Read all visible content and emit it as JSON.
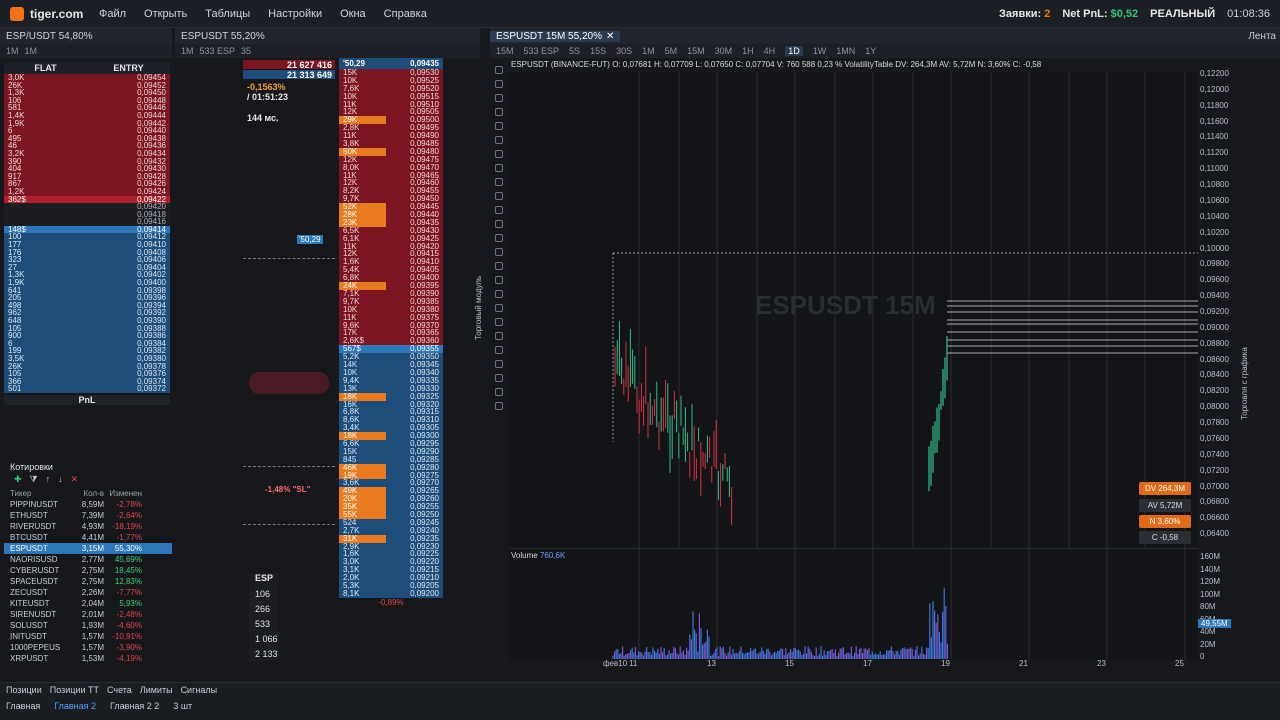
{
  "app": {
    "logo": "tiger.com",
    "menu": [
      "Файл",
      "Открыть",
      "Таблицы",
      "Настройки",
      "Окна",
      "Справка"
    ],
    "orders_label": "Заявки:",
    "orders_count": "2",
    "netpnl_label": "Net PnL:",
    "netpnl_value": "$0,52",
    "mode": "РЕАЛЬНЫЙ",
    "clock": "01:08:36"
  },
  "tabs": {
    "left": "ESP/USDT 54,80%",
    "middle": "ESPUSDT 55,20%",
    "chart": "ESPUSDT 15M 55,20%",
    "feed": "Лента"
  },
  "toolbar_left": [
    "1M",
    "1M"
  ],
  "toolbar_mid": [
    "1M",
    "533 ESP",
    "35"
  ],
  "toolbar_chart": [
    "15M",
    "533 ESP",
    "5S",
    "15S",
    "30S",
    "1M",
    "5M",
    "15M",
    "30M",
    "1H",
    "4H",
    "1D",
    "1W",
    "1MN",
    "1Y"
  ],
  "flat": {
    "col1": "FLAT",
    "col2": "ENTRY",
    "red_rows": [
      [
        "3,0K",
        "0,09454"
      ],
      [
        "26K",
        "0,09452"
      ],
      [
        "1,3K",
        "0,09450"
      ],
      [
        "106",
        "0,09448"
      ],
      [
        "581",
        "0,09446"
      ],
      [
        "1,4K",
        "0,09444"
      ],
      [
        "1,9K",
        "0,09442"
      ],
      [
        "6",
        "0,09440"
      ],
      [
        "495",
        "0,09438"
      ],
      [
        "46",
        "0,09436"
      ],
      [
        "3,2K",
        "0,09434"
      ],
      [
        "390",
        "0,09432"
      ],
      [
        "404",
        "0,09430"
      ],
      [
        "917",
        "0,09428"
      ],
      [
        "867",
        "0,09426"
      ],
      [
        "1,2K",
        "0,09424"
      ]
    ],
    "hl_row": [
      "362$",
      "0,09422"
    ],
    "dark_rows": [
      [
        "",
        "0,09420"
      ],
      [
        "",
        "0,09418"
      ],
      [
        "",
        "0,09416"
      ]
    ],
    "sel_row": [
      "148$",
      "0,09414"
    ],
    "blue_rows": [
      [
        "100",
        "0,09412"
      ],
      [
        "177",
        "0,09410"
      ],
      [
        "176",
        "0,09408"
      ],
      [
        "323",
        "0,09406"
      ],
      [
        "27",
        "0,09404"
      ],
      [
        "1,3K",
        "0,09402"
      ],
      [
        "1,9K",
        "0,09400"
      ],
      [
        "641",
        "0,09398"
      ],
      [
        "205",
        "0,09396"
      ],
      [
        "498",
        "0,09394"
      ],
      [
        "962",
        "0,09392"
      ],
      [
        "648",
        "0,09390"
      ],
      [
        "105",
        "0,09388"
      ],
      [
        "900",
        "0,09386"
      ],
      [
        "6",
        "0,09384"
      ],
      [
        "199",
        "0,09382"
      ],
      [
        "3,5K",
        "0,09380"
      ],
      [
        "26K",
        "0,09378"
      ],
      [
        "105",
        "0,09376"
      ],
      [
        "366",
        "0,09374"
      ],
      [
        "501",
        "0,09372"
      ]
    ],
    "pnl": "PnL"
  },
  "mid": {
    "vol1": "21 627 416",
    "vol2": "21 313 649",
    "pct": "-0,1563%",
    "time": "/ 01:51:23",
    "latency": "144 мс.",
    "marker": "'50,29",
    "sl": "-1,48% \"SL\"",
    "esp_label": "ESP",
    "esp_vals": [
      "106",
      "266",
      "533",
      "1 066",
      "2 133"
    ]
  },
  "ladder": {
    "top_price": "0,09435",
    "top_label": "'50,29",
    "red": [
      [
        "15K",
        "0,09530"
      ],
      [
        "10K",
        "0,09525"
      ],
      [
        "7,6K",
        "0,09520"
      ],
      [
        "10K",
        "0,09515"
      ],
      [
        "11K",
        "0,09510"
      ],
      [
        "12K",
        "0,09505"
      ],
      [
        "29K",
        "0,09500"
      ],
      [
        "2,8K",
        "0,09495"
      ],
      [
        "11K",
        "0,09490"
      ],
      [
        "3,8K",
        "0,09485"
      ],
      [
        "50K",
        "0,09480"
      ],
      [
        "12K",
        "0,09475"
      ],
      [
        "8,0K",
        "0,09470"
      ],
      [
        "11K",
        "0,09465"
      ],
      [
        "12K",
        "0,09460"
      ],
      [
        "8,2K",
        "0,09455"
      ],
      [
        "9,7K",
        "0,09450"
      ],
      [
        "52K",
        "0,09445"
      ],
      [
        "28K",
        "0,09440"
      ],
      [
        "23K",
        "0,09435"
      ],
      [
        "6,5K",
        "0,09430"
      ],
      [
        "6,1K",
        "0,09425"
      ],
      [
        "11K",
        "0,09420"
      ],
      [
        "12K",
        "0,09415"
      ],
      [
        "1,6K",
        "0,09410"
      ],
      [
        "5,4K",
        "0,09405"
      ],
      [
        "6,8K",
        "0,09400"
      ],
      [
        "24K",
        "0,09395"
      ],
      [
        "7,1K",
        "0,09390"
      ],
      [
        "9,7K",
        "0,09385"
      ],
      [
        "10K",
        "0,09380"
      ],
      [
        "11K",
        "0,09375"
      ],
      [
        "9,6K",
        "0,09370"
      ],
      [
        "17K",
        "0,09365"
      ],
      [
        "2,6K$",
        "0,09360"
      ]
    ],
    "cur": [
      "567$",
      "0,09355"
    ],
    "blue": [
      [
        "5,2K",
        "0,09350"
      ],
      [
        "14K",
        "0,09345"
      ],
      [
        "10K",
        "0,09340"
      ],
      [
        "9,4K",
        "0,09335"
      ],
      [
        "13K",
        "0,09330"
      ],
      [
        "18K",
        "0,09325"
      ],
      [
        "16K",
        "0,09320"
      ],
      [
        "6,8K",
        "0,09315"
      ],
      [
        "8,6K",
        "0,09310"
      ],
      [
        "3,4K",
        "0,09305"
      ],
      [
        "18K",
        "0,09300"
      ],
      [
        "6,6K",
        "0,09295"
      ],
      [
        "15K",
        "0,09290"
      ],
      [
        "845",
        "0,09285"
      ],
      [
        "46K",
        "0,09280"
      ],
      [
        "19K",
        "0,09275"
      ],
      [
        "3,6K",
        "0,09270"
      ],
      [
        "49K",
        "0,09265"
      ],
      [
        "20K",
        "0,09260"
      ],
      [
        "35K",
        "0,09255"
      ],
      [
        "55K",
        "0,09250"
      ],
      [
        "524",
        "0,09245"
      ],
      [
        "2,7K",
        "0,09240"
      ],
      [
        "31K",
        "0,09235"
      ],
      [
        "2,9K",
        "0,09230"
      ],
      [
        "1,6K",
        "0,09225"
      ],
      [
        "3,0K",
        "0,09220"
      ],
      [
        "3,1K",
        "0,09215"
      ],
      [
        "2,0K",
        "0,09210"
      ],
      [
        "5,3K",
        "0,09205"
      ],
      [
        "8,1K",
        "0,09200"
      ]
    ],
    "bottom": "-0,89%"
  },
  "quotes": {
    "title": "Котировки",
    "col1": "Тикер",
    "col2": "Кол-в",
    "col3": "Изменен",
    "rows": [
      [
        "PIPPINUSDT",
        "8,59M",
        "-2,78%",
        "neg"
      ],
      [
        "ETHUSDT",
        "7,39M",
        "-2,64%",
        "neg"
      ],
      [
        "RIVERUSDT",
        "4,93M",
        "-18,19%",
        "neg"
      ],
      [
        "BTCUSDT",
        "4,41M",
        "-1,77%",
        "neg"
      ],
      [
        "ESPUSDT",
        "3,15M",
        "55,30%",
        "sel"
      ],
      [
        "NAORISUSD",
        "2,77M",
        "45,69%",
        "pos"
      ],
      [
        "CYBERUSDT",
        "2,75M",
        "18,45%",
        "pos"
      ],
      [
        "SPACEUSDT",
        "2,75M",
        "12,83%",
        "pos"
      ],
      [
        "ZECUSDT",
        "2,26M",
        "-7,77%",
        "neg"
      ],
      [
        "KITEUSDT",
        "2,04M",
        "5,93%",
        "pos"
      ],
      [
        "SIRENUSDT",
        "2,01M",
        "-2,48%",
        "neg"
      ],
      [
        "SOLUSDT",
        "1,93M",
        "-4,60%",
        "neg"
      ],
      [
        "INITUSDT",
        "1,57M",
        "-10,91%",
        "neg"
      ],
      [
        "1000PEPEUS",
        "1,57M",
        "-3,90%",
        "neg"
      ],
      [
        "XRPUSDT",
        "1,53M",
        "-4,19%",
        "neg"
      ]
    ]
  },
  "chart": {
    "info": "ESPUSDT (BINANCE-FUT) O: 0,07681  H: 0,07709  L: 0,07650  C: 0,07704  V: 760 588  0,23 %  VolatilityTable DV: 264,3M  AV: 5,72M  N: 3,60%  C: -0,58",
    "watermark": "ESPUSDT 15M",
    "y_labels": [
      "0,12200",
      "0,12000",
      "0,11800",
      "0,11600",
      "0,11400",
      "0,11200",
      "0,11000",
      "0,10800",
      "0,10600",
      "0,10400",
      "0,10200",
      "0,10000",
      "0,09800",
      "0,09600",
      "0,09400",
      "0,09200",
      "0,09000",
      "0,08800",
      "0,08600",
      "0,08400",
      "0,08200",
      "0,08000",
      "0,07800",
      "0,07600",
      "0,07400",
      "0,07200",
      "0,07000",
      "0,06800",
      "0,06600",
      "0,06400"
    ],
    "x_labels": [
      "фев10",
      "11",
      "13",
      "15",
      "17",
      "19",
      "21",
      "23",
      "25"
    ],
    "badges": {
      "dv": "DV 264,3M",
      "av": "AV 5,72M",
      "n": "N 3,60%",
      "c": "C -0,58"
    },
    "volume_title": "Volume",
    "volume_val": "760,6K",
    "vol_labels": [
      "160M",
      "140M",
      "120M",
      "100M",
      "80M",
      "60M",
      "40M",
      "20M",
      "0"
    ],
    "vol_tag": "49,55M",
    "side_left": "Торговый модуль",
    "side_right": "Торговля с графика"
  },
  "bottom": {
    "tabs1": [
      "Позиции",
      "Позиции ТТ",
      "Счета",
      "Лимиты",
      "Сигналы"
    ],
    "tabs2": [
      "Главная",
      "Главная 2",
      "Главная 2 2",
      "3 шт"
    ]
  }
}
